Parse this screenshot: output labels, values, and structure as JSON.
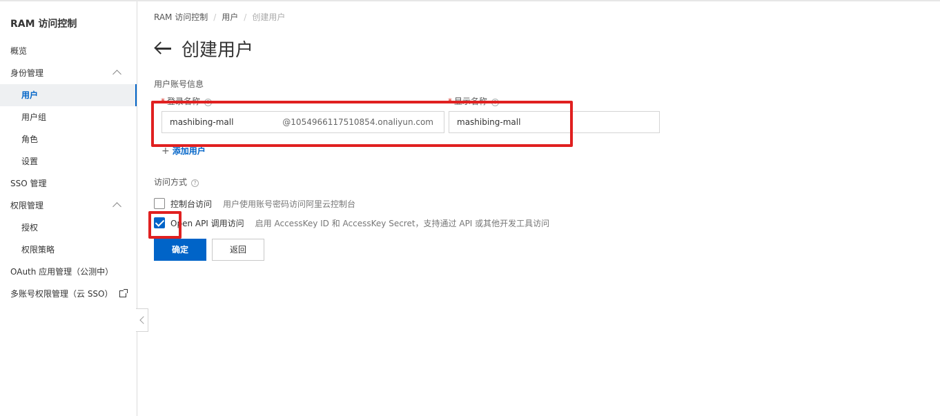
{
  "sidebar": {
    "title": "RAM 访问控制",
    "items": [
      {
        "label": "概览"
      },
      {
        "label": "身份管理"
      },
      {
        "label": "用户"
      },
      {
        "label": "用户组"
      },
      {
        "label": "角色"
      },
      {
        "label": "设置"
      },
      {
        "label": "SSO 管理"
      },
      {
        "label": "权限管理"
      },
      {
        "label": "授权"
      },
      {
        "label": "权限策略"
      },
      {
        "label": "OAuth 应用管理（公测中）"
      },
      {
        "label": "多账号权限管理（云 SSO）"
      }
    ],
    "active_item": "用户"
  },
  "breadcrumb": [
    "RAM 访问控制",
    "用户",
    "创建用户"
  ],
  "page": {
    "title": "创建用户"
  },
  "form": {
    "section_account": "用户账号信息",
    "login_name_label": "登录名称",
    "login_name_value": "mashibing-mall",
    "login_name_suffix": "@1054966117510854.onaliyun.com",
    "display_name_label": "显示名称",
    "display_name_value": "mashibing-mall",
    "add_user": "添加用户",
    "access_label": "访问方式",
    "console_access": {
      "label": "控制台访问",
      "description": "用户使用账号密码访问阿里云控制台",
      "checked": false
    },
    "api_access": {
      "label": "Open API 调用访问",
      "description": "启用 AccessKey ID 和 AccessKey Secret，支持通过 API 或其他开发工具访问",
      "checked": true
    },
    "confirm_button": "确定",
    "back_button": "返回"
  },
  "colors": {
    "primary": "#0064c8",
    "annotation": "#e02020",
    "required": "#d93026"
  },
  "icons": {
    "back": "back-arrow-icon",
    "help": "help-circle-icon",
    "external": "external-link-icon",
    "chevron": "chevron-up-icon",
    "collapse": "chevron-left-icon"
  }
}
